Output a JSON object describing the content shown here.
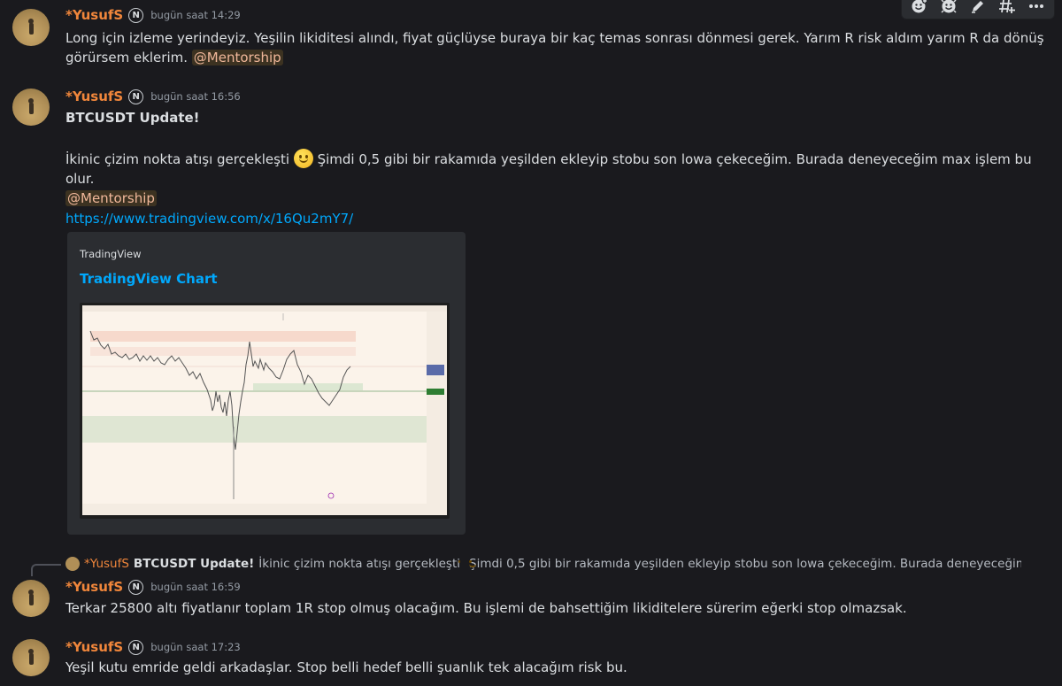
{
  "toolbar": {
    "icons": [
      "add-reaction-icon",
      "add-super-reaction-icon",
      "edit-icon",
      "create-thread-icon",
      "more-icon"
    ]
  },
  "messages": [
    {
      "username": "*YusufS",
      "badge": "N",
      "timestamp": "bugün saat 14:29",
      "text_line1": "Long için izleme yerindeyiz. Yeşilin likiditesi alındı, fiyat güçlüyse buraya bir kaç temas sonrası dönmesi gerek. Yarım R risk aldım yarım R da dönüş",
      "text_line2": "görürsem eklerim.",
      "mention": "@Mentorship"
    },
    {
      "username": "*YusufS",
      "badge": "N",
      "timestamp": "bugün saat 16:56",
      "title": "BTCUSDT Update!",
      "body_part1": "İkinic çizim nokta atışı gerçekleşti",
      "body_part2": "Şimdi 0,5 gibi bir rakamıda yeşilden ekleyip stobu son lowa çekeceğim. Burada deneyeceğim max işlem bu olur.",
      "mention": "@Mentorship",
      "link": "https://www.tradingview.com/x/16Qu2mY7/",
      "embed": {
        "provider": "TradingView",
        "title": "TradingView Chart"
      }
    },
    {
      "username": "*YusufS",
      "badge": "N",
      "timestamp": "bugün saat 16:59",
      "reply": {
        "username": "*YusufS",
        "bold": "BTCUSDT Update!",
        "part1": "İkinic çizim nokta atışı gerçekleşti",
        "part2": "Şimdi 0,5 gibi bir rakamıda yeşilden ekleyip stobu son lowa çekeceğim. Burada deneyeceğim max işlem"
      },
      "text": "Terkar 25800 altı fiyatlanır toplam 1R stop olmuş olacağım. Bu işlemi de bahsettiğim likiditelere sürerim eğerki stop olmazsak."
    },
    {
      "username": "*YusufS",
      "badge": "N",
      "timestamp": "bugün saat 17:23",
      "text": "Yeşil kutu emride geldi arkadaşlar. Stop belli hedef belli şuanlık tek alacağım risk bu."
    }
  ]
}
